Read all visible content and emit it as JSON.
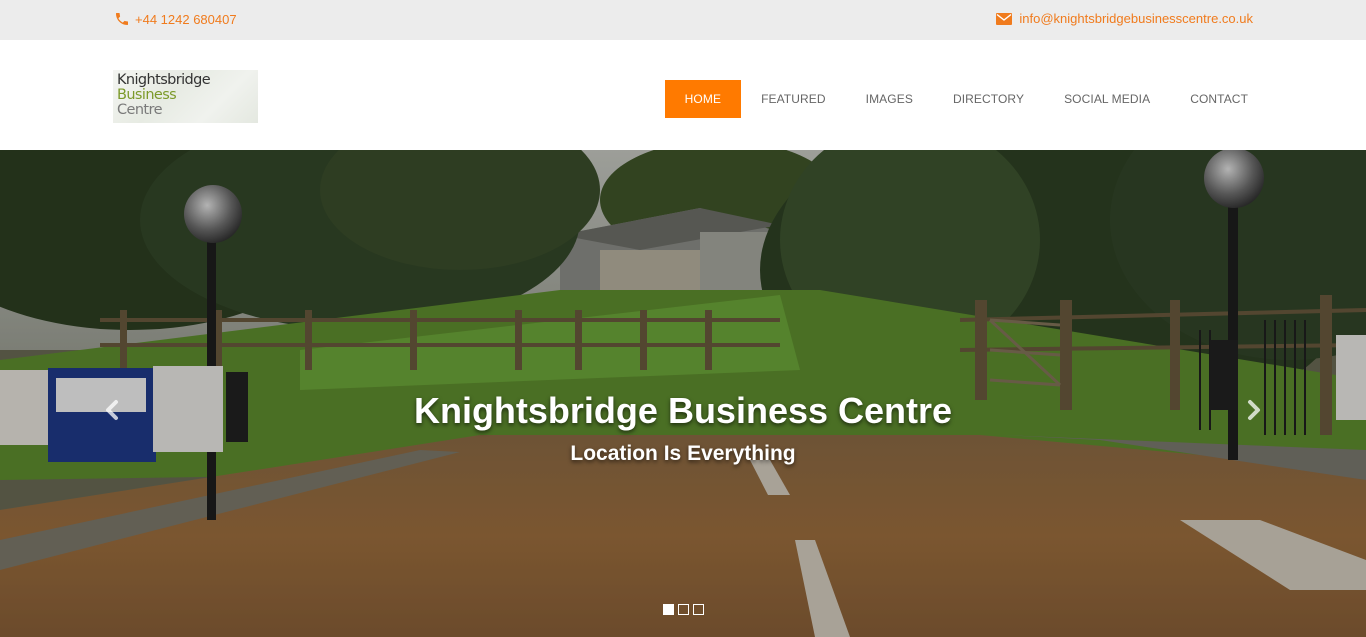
{
  "topbar": {
    "phone": "+44 1242 680407",
    "email": "info@knightsbridgebusinesscentre.co.uk",
    "phone_icon": "phone-icon",
    "email_icon": "envelope-icon"
  },
  "logo": {
    "line1": "Knightsbridge",
    "line2": "Business",
    "line3": "Centre"
  },
  "nav": {
    "items": [
      {
        "label": "HOME",
        "active": true
      },
      {
        "label": "FEATURED",
        "active": false
      },
      {
        "label": "IMAGES",
        "active": false
      },
      {
        "label": "DIRECTORY",
        "active": false
      },
      {
        "label": "SOCIAL MEDIA",
        "active": false
      },
      {
        "label": "CONTACT",
        "active": false
      }
    ]
  },
  "hero": {
    "title": "Knightsbridge Business Centre",
    "subtitle": "Location Is Everything",
    "prev_icon": "chevron-left-icon",
    "next_icon": "chevron-right-icon",
    "slide_count": 3,
    "active_slide": 1
  },
  "colors": {
    "accent": "#ff7a00",
    "topbar_bg": "#ececec",
    "link": "#f07b1d",
    "nav_text": "#666666"
  }
}
